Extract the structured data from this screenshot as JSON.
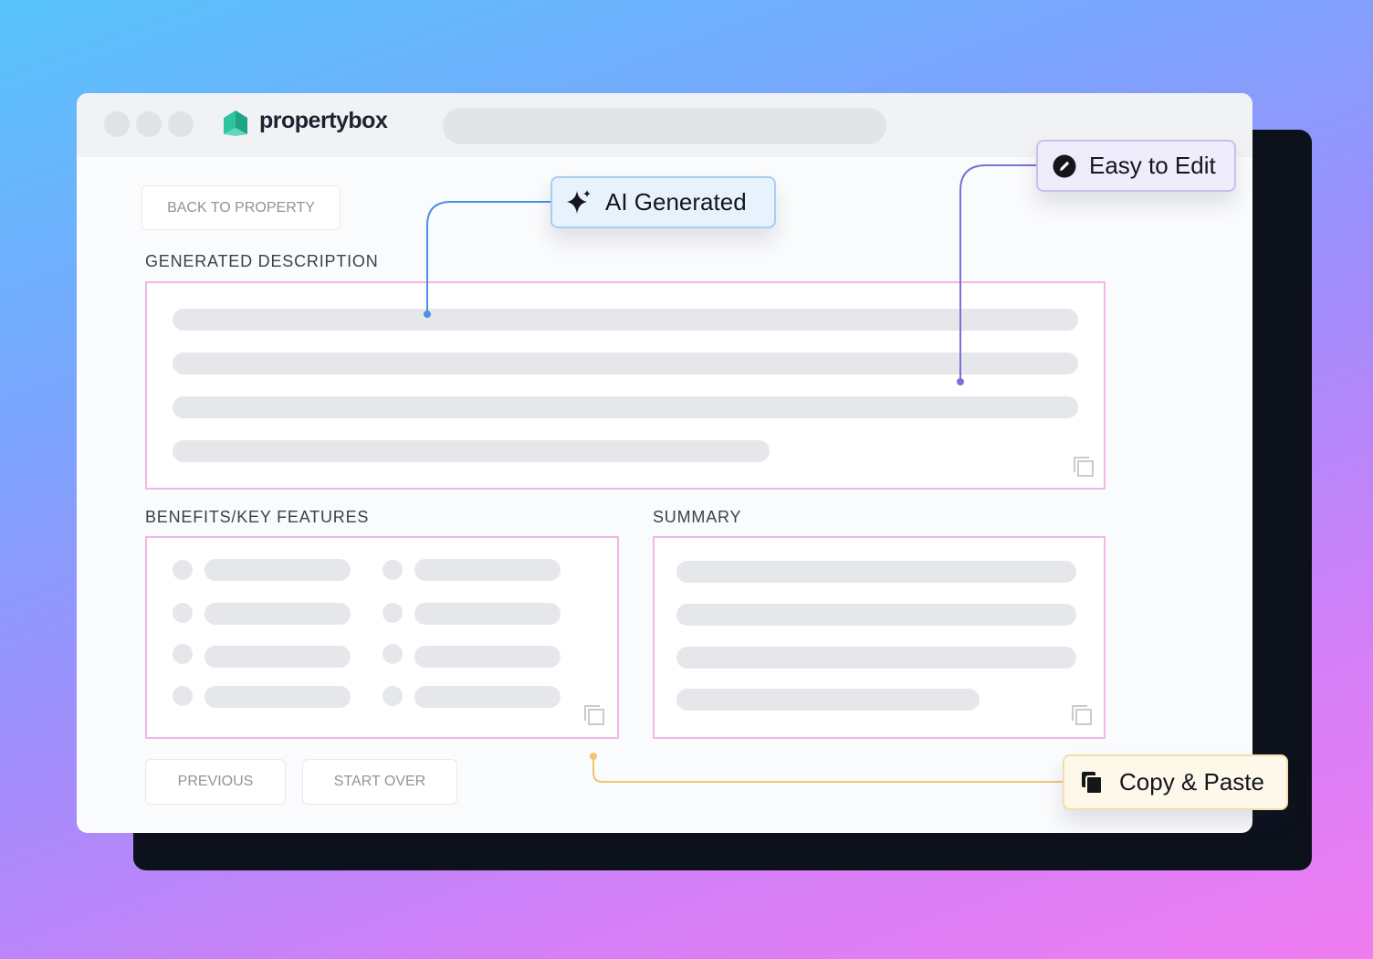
{
  "app": {
    "brand_name": "propertybox",
    "brand_color": "#2ec4a0"
  },
  "nav": {
    "back_button": "BACK TO PROPERTY"
  },
  "sections": {
    "description_label": "GENERATED DESCRIPTION",
    "features_label": "BENEFITS/KEY FEATURES",
    "summary_label": "SUMMARY"
  },
  "footer": {
    "previous_button": "PREVIOUS",
    "start_over_button": "START OVER"
  },
  "callouts": {
    "ai_generated": {
      "label": "AI Generated",
      "icon": "sparkle-icon",
      "color": "#4a8fe8"
    },
    "easy_to_edit": {
      "label": "Easy to Edit",
      "icon": "edit-icon",
      "color": "#7b6fd8"
    },
    "copy_paste": {
      "label": "Copy & Paste",
      "icon": "copy-icon",
      "color": "#f0c66e"
    }
  },
  "colors": {
    "panel_border": "#f0b7e8",
    "skeleton": "#e6e7ea",
    "backdrop_dark": "#0d111c"
  }
}
